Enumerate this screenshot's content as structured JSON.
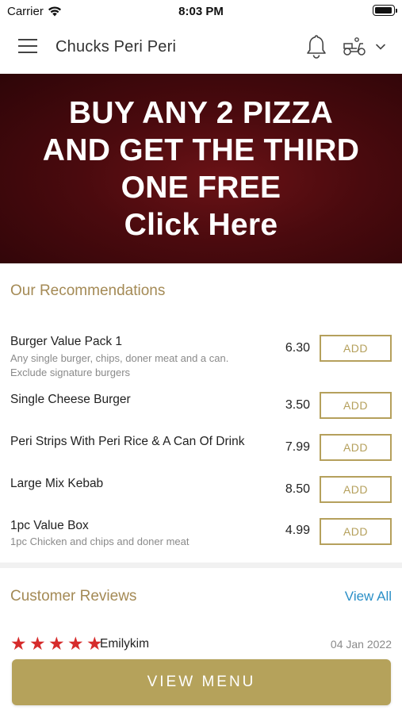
{
  "status_bar": {
    "carrier": "Carrier",
    "time": "8:03 PM"
  },
  "header": {
    "title": "Chucks Peri Peri"
  },
  "banner": {
    "lines": [
      "BUY ANY 2 PIZZA",
      "AND GET THE THIRD",
      "ONE FREE",
      "Click Here"
    ]
  },
  "recommendations": {
    "title": "Our Recommendations",
    "items": [
      {
        "name": "Burger Value Pack 1",
        "description": "Any single burger, chips, doner meat and a can. Exclude signature burgers",
        "price": "6.30",
        "button": "ADD"
      },
      {
        "name": "Single Cheese Burger",
        "description": "",
        "price": "3.50",
        "button": "ADD"
      },
      {
        "name": "Peri Strips With Peri Rice & A Can Of Drink",
        "description": "",
        "price": "7.99",
        "button": "ADD"
      },
      {
        "name": "Large Mix Kebab",
        "description": "",
        "price": "8.50",
        "button": "ADD"
      },
      {
        "name": "1pc Value Box",
        "description": "1pc Chicken and chips and doner meat",
        "price": "4.99",
        "button": "ADD"
      }
    ]
  },
  "reviews": {
    "title": "Customer Reviews",
    "view_all": "View All",
    "items": [
      {
        "stars": 5,
        "reviewer": "Emilykim",
        "date": "04 Jan 2022"
      }
    ]
  },
  "footer": {
    "view_menu": "VIEW MENU"
  },
  "colors": {
    "accent": "#b5a25b",
    "banner": "#4a0a0e",
    "link": "#2a8fc7",
    "star": "#d62b2b"
  }
}
